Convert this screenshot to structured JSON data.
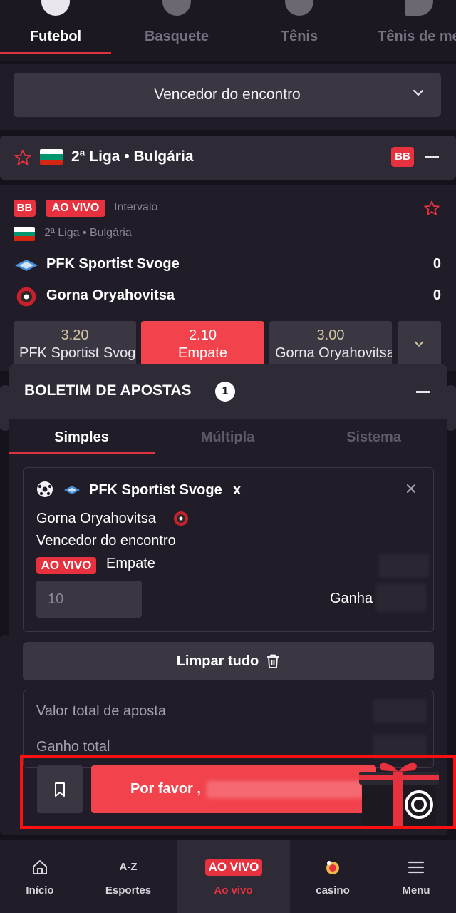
{
  "sport_tabs": [
    {
      "label": "Futebol",
      "icon": "soccer-ball-icon",
      "active": true
    },
    {
      "label": "Basquete",
      "icon": "basketball-icon",
      "active": false
    },
    {
      "label": "Tênis",
      "icon": "tennis-ball-icon",
      "active": false
    },
    {
      "label": "Tênis de me",
      "icon": "table-tennis-icon",
      "active": false
    }
  ],
  "market_selector": {
    "value": "Vencedor do encontro",
    "icon": "chevron-down-icon"
  },
  "league_header": {
    "title": "2ª Liga • Bulgária",
    "badge": "BB",
    "icon": "star-icon"
  },
  "match": {
    "badge": "BB",
    "live_label": "AO VIVO",
    "status": "Intervalo",
    "league": "2ª Liga • Bulgária",
    "home": {
      "name": "PFK Sportist Svoge",
      "score": "0"
    },
    "away": {
      "name": "Gorna Oryahovitsa",
      "score": "0"
    },
    "odds": [
      {
        "value": "3.20",
        "label": "PFK Sportist Svoge",
        "selected": false
      },
      {
        "value": "2.10",
        "label": "Empate",
        "selected": true
      },
      {
        "value": "3.00",
        "label": "Gorna Oryahovitsa",
        "selected": false
      }
    ]
  },
  "bet_slip": {
    "title": "BOLETIM DE APOSTAS",
    "count": "1",
    "tabs": [
      "Simples",
      "Múltipla",
      "Sistema"
    ],
    "bet": {
      "home": "PFK Sportist Svoge",
      "separator": "x",
      "away": "Gorna Oryahovitsa",
      "market": "Vencedor do encontro",
      "live_label": "AO VIVO",
      "pick": "Empate",
      "stake_placeholder": "10",
      "win_label": "Ganha"
    },
    "clear_label": "Limpar tudo",
    "total_stake_label": "Valor total de aposta",
    "total_win_label": "Ganho total",
    "place_label": "Por favor ,"
  },
  "bottom_nav": [
    {
      "label": "Início",
      "icon": "home-icon"
    },
    {
      "label": "Esportes",
      "icon": "a-z-icon",
      "icon_text": "A-Z"
    },
    {
      "label": "Ao vivo",
      "icon": "live-icon",
      "badge": "AO VIVO",
      "active": true
    },
    {
      "label": "casino",
      "icon": "casino-icon"
    },
    {
      "label": "Menu",
      "icon": "menu-icon"
    }
  ],
  "colors": {
    "accent": "#e8313f",
    "background": "#15121c",
    "surface": "#201c28",
    "button": "#3a3642"
  }
}
